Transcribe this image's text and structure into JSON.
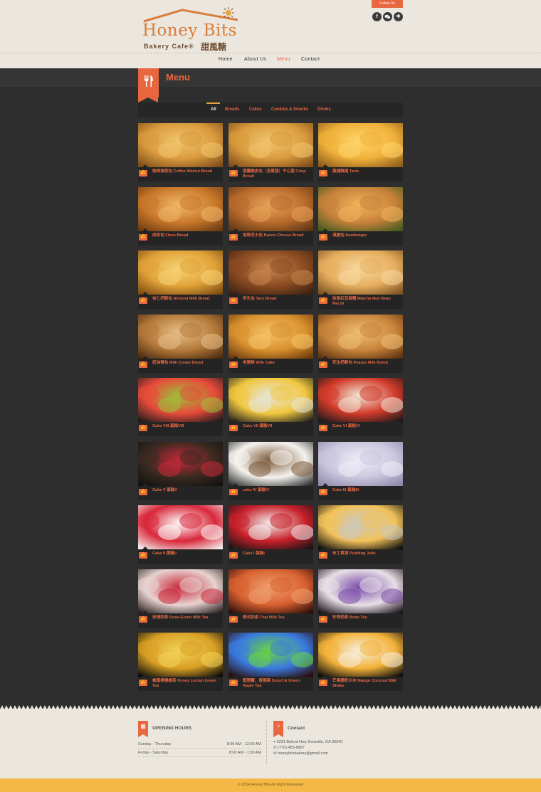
{
  "brand": {
    "name": "Honey Bits",
    "tagline": "Bakery Cafe®",
    "chinese": "甜風糖"
  },
  "social": {
    "follow_label": "Follow Us",
    "icons": [
      "facebook-icon",
      "wechat-icon",
      "yelp-icon"
    ]
  },
  "nav": [
    {
      "label": "Home",
      "active": false
    },
    {
      "label": "About Us",
      "active": false
    },
    {
      "label": "Menu",
      "active": true
    },
    {
      "label": "Contact",
      "active": false
    }
  ],
  "page_title": "Menu",
  "filters": [
    {
      "label": "All",
      "active": true
    },
    {
      "label": "Breads",
      "active": false
    },
    {
      "label": "Cakes",
      "active": false
    },
    {
      "label": "Cookies & Snacks",
      "active": false
    },
    {
      "label": "Drinks",
      "active": false
    }
  ],
  "menu_items": [
    {
      "caption": "咖啡核桃包 Coffee Walnut Bread",
      "kind": "bread"
    },
    {
      "caption": "菠蘿脆皮包（芝蔴菠）千心菠 Crisp Bread",
      "kind": "bread"
    },
    {
      "caption": "蛋撻酥撻 Tarts",
      "kind": "tart"
    },
    {
      "caption": "肉松包 Floss Bread",
      "kind": "floss"
    },
    {
      "caption": "培根芝士包 Bacon Cheese Bread",
      "kind": "bacon"
    },
    {
      "caption": "漢堡包 Hamburger",
      "kind": "burger"
    },
    {
      "caption": "杏仁奶酥包 Almond Milk Bread",
      "kind": "almond"
    },
    {
      "caption": "芋头包 Taro Bread",
      "kind": "taro"
    },
    {
      "caption": "抹茶紅豆麻糬 Matcha Red Bean Mochi",
      "kind": "mochi"
    },
    {
      "caption": "奶油餐包 Milk Cream Bread",
      "kind": "cream"
    },
    {
      "caption": "老婆餅 Wife Cake",
      "kind": "wife"
    },
    {
      "caption": "花生奶酥包 Peanut Milk Bomb",
      "kind": "peanut"
    },
    {
      "caption": "Cake VIII 蛋糕VIII",
      "kind": "cake-fruit"
    },
    {
      "caption": "Cake VII 蛋糕VII",
      "kind": "cake-mango"
    },
    {
      "caption": "Cake VI 蛋糕VI",
      "kind": "cake-choc"
    },
    {
      "caption": "Cake V 蛋糕V",
      "kind": "cake-dark"
    },
    {
      "caption": "cake IV 蛋糕IV",
      "kind": "cake-white"
    },
    {
      "caption": "Cake III 蛋糕III",
      "kind": "cake-bow"
    },
    {
      "caption": "Cake II 蛋糕II",
      "kind": "cake-love"
    },
    {
      "caption": "Cake I 蛋糕I",
      "kind": "cake-straw"
    },
    {
      "caption": "布丁果凍 Pudding Jello",
      "kind": "pudding"
    },
    {
      "caption": "玫瑰奶茶 Rose Green Milk Tea",
      "kind": "rose-tea"
    },
    {
      "caption": "泰式奶茶 Thai Milk Tea",
      "kind": "thai-tea"
    },
    {
      "caption": "珍珠奶茶 Boba Tea",
      "kind": "boba"
    },
    {
      "caption": "蜂蜜檸檬綠茶 Honey Lemon Green Tea",
      "kind": "lemon-tea"
    },
    {
      "caption": "藍精靈、青蘋果 Smurf & Green Apple Tea",
      "kind": "smurf"
    },
    {
      "caption": "芒果椰奶沙冰 Mango Coconut Milk Shake",
      "kind": "mango-shake"
    }
  ],
  "footer": {
    "hours_title": "OPENING HOURS",
    "hours": [
      {
        "days": "Sunday - Thursday",
        "time": "8:00 AM - 12:00 AM"
      },
      {
        "days": "Friday - Saturday",
        "time": "8:00 AM - 1:00 AM"
      }
    ],
    "contact_title": "Contact",
    "contact": [
      {
        "icon": "location-icon",
        "text": "5231 Buford Hwy Doraville, GA 30340"
      },
      {
        "icon": "phone-icon",
        "text": "(770) 455-8867"
      },
      {
        "icon": "mail-icon",
        "text": "honeybitsbakery@gmail.com"
      }
    ],
    "copyright": "© 2014 Honey Bits All Right Reserved"
  },
  "colors": {
    "accent": "#e9673f",
    "header_bg": "#ebe7df",
    "body_bg": "#2e2e2e",
    "card_bg": "#242424",
    "copyright_bar": "#f3b845"
  }
}
